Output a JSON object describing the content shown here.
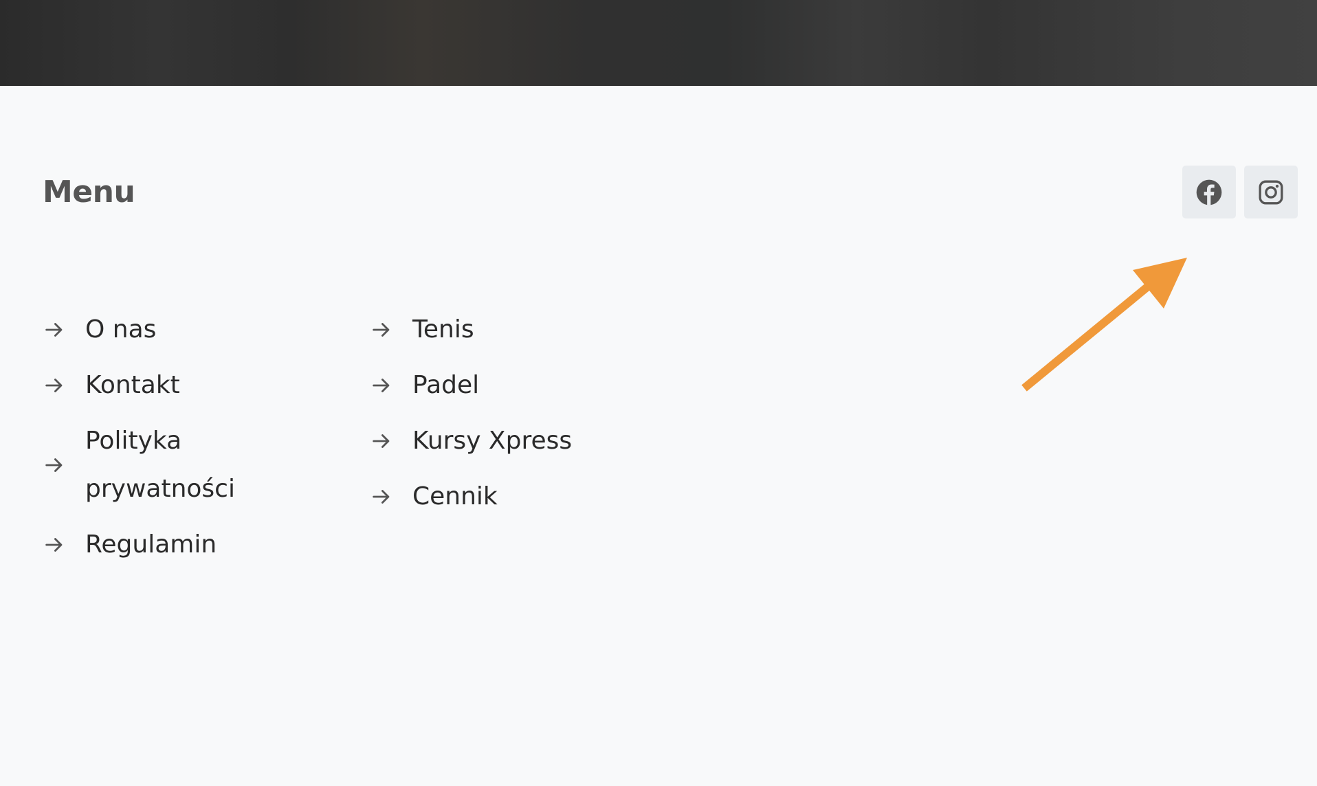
{
  "footer": {
    "menu_title": "Menu",
    "left_links": [
      {
        "label": "O nas"
      },
      {
        "label": "Kontakt"
      },
      {
        "label": "Polityka prywatności"
      },
      {
        "label": "Regulamin"
      }
    ],
    "right_links": [
      {
        "label": "Tenis"
      },
      {
        "label": "Padel"
      },
      {
        "label": "Kursy Xpress"
      },
      {
        "label": "Cennik"
      }
    ],
    "social": [
      {
        "name": "facebook-icon"
      },
      {
        "name": "instagram-icon"
      }
    ]
  },
  "colors": {
    "background": "#f8f9fa",
    "social_bg": "#e9ecef",
    "icon": "#555555",
    "text": "#2a2a2a",
    "annotation_arrow": "#f0993a"
  }
}
